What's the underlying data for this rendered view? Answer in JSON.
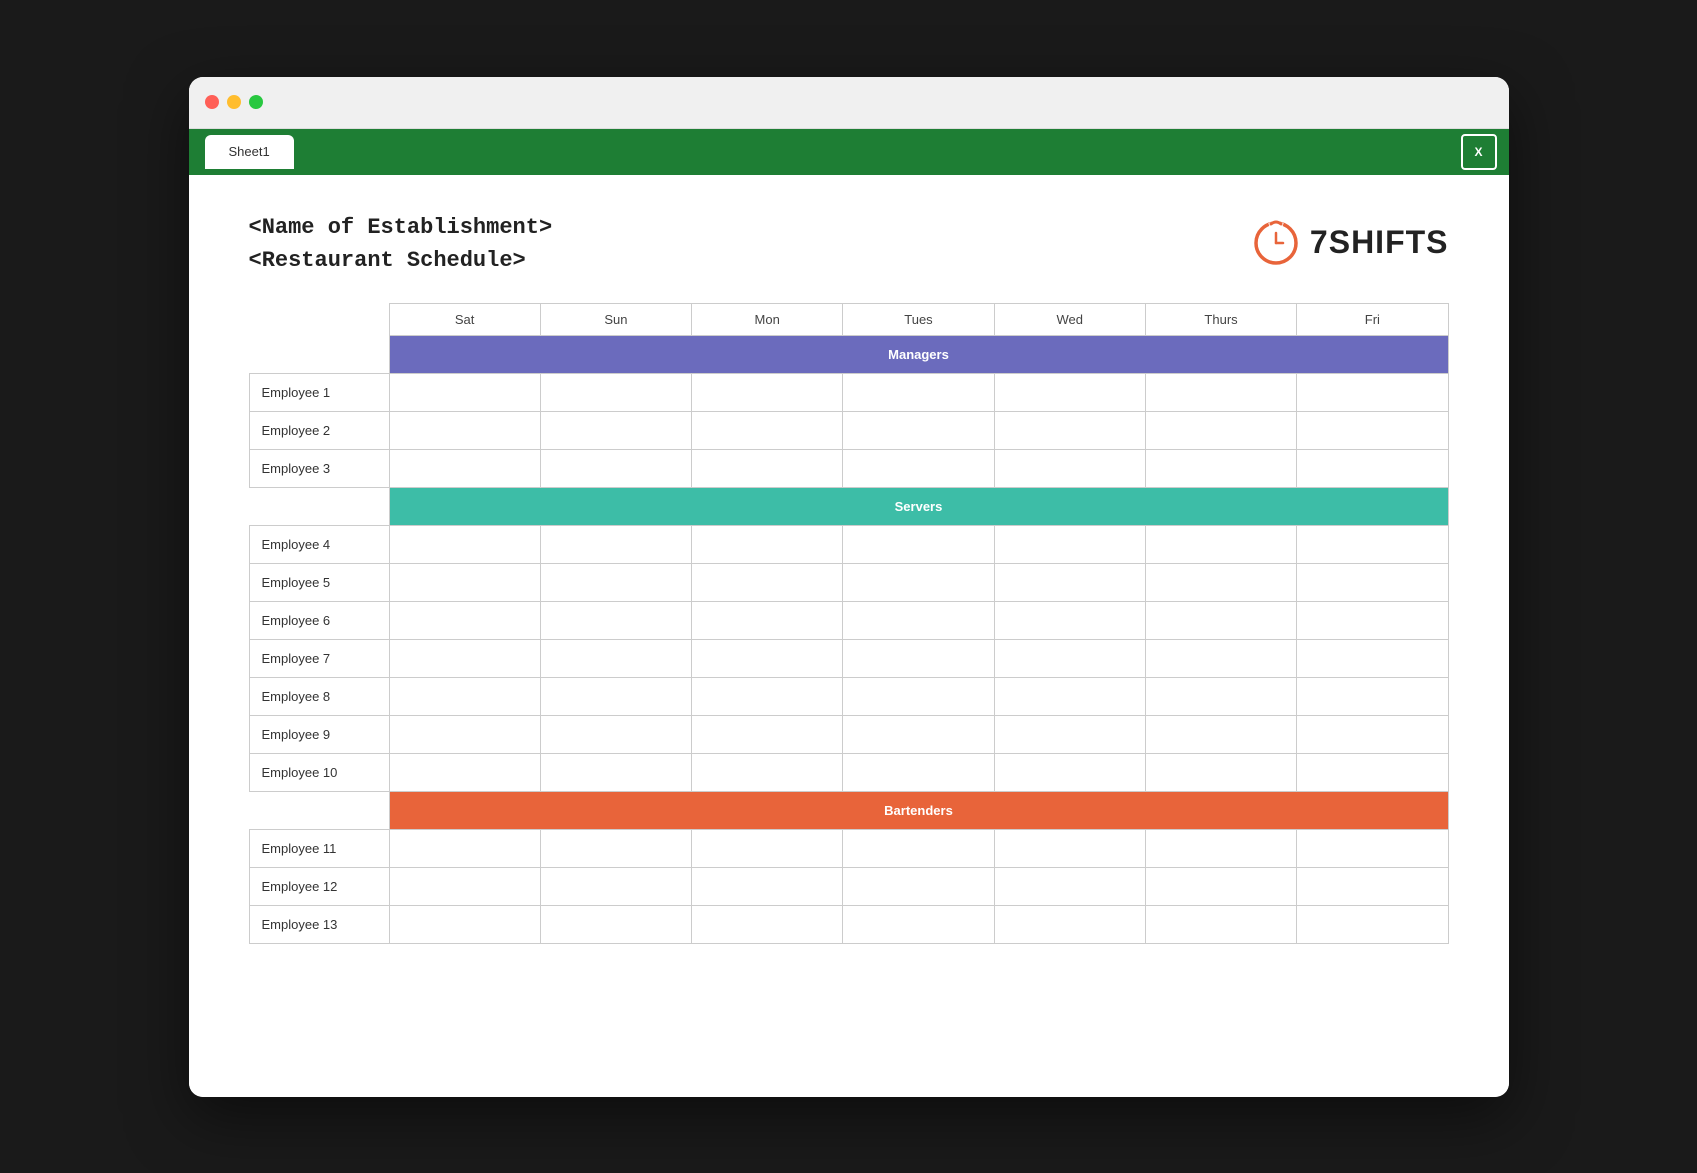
{
  "window": {
    "tab_label": "Sheet1"
  },
  "header": {
    "establishment": "<Name of Establishment>",
    "schedule_type": "<Restaurant Schedule>",
    "logo_text": "7SHIFTS"
  },
  "table": {
    "days": [
      "Sat",
      "Sun",
      "Mon",
      "Tues",
      "Wed",
      "Thurs",
      "Fri"
    ],
    "categories": [
      {
        "name": "Managers",
        "color_class": "managers-row",
        "employees": [
          "Employee 1",
          "Employee 2",
          "Employee 3"
        ]
      },
      {
        "name": "Servers",
        "color_class": "servers-row",
        "employees": [
          "Employee 4",
          "Employee 5",
          "Employee 6",
          "Employee 7",
          "Employee 8",
          "Employee 9",
          "Employee 10"
        ]
      },
      {
        "name": "Bartenders",
        "color_class": "bartenders-row",
        "employees": [
          "Employee 11",
          "Employee 12",
          "Employee 13"
        ]
      }
    ]
  },
  "colors": {
    "toolbar_green": "#1e7e34",
    "managers_purple": "#6b6bbd",
    "servers_teal": "#3dbda7",
    "bartenders_orange": "#e8643a",
    "logo_orange": "#e8643a"
  }
}
